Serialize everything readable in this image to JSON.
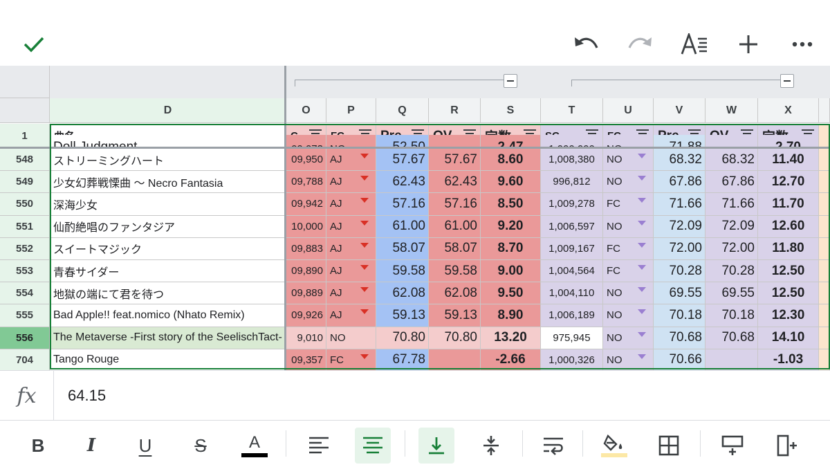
{
  "toolbar": {
    "icons": [
      "check-icon",
      "undo-icon",
      "redo-icon",
      "text-format-icon",
      "add-icon",
      "more-icon"
    ]
  },
  "columns": [
    {
      "id": "D",
      "label": "D"
    },
    {
      "id": "O",
      "label": "O"
    },
    {
      "id": "P",
      "label": "P"
    },
    {
      "id": "Q",
      "label": "Q"
    },
    {
      "id": "R",
      "label": "R"
    },
    {
      "id": "S",
      "label": "S"
    },
    {
      "id": "T",
      "label": "T"
    },
    {
      "id": "U",
      "label": "U"
    },
    {
      "id": "V",
      "label": "V"
    },
    {
      "id": "W",
      "label": "W"
    },
    {
      "id": "X",
      "label": "X"
    }
  ],
  "header_row": {
    "number": "1",
    "cells": [
      "曲名",
      "C",
      "FC",
      "Pre",
      "OV",
      "定数",
      "SC",
      "FC",
      "Pre",
      "OV",
      "定数"
    ]
  },
  "partial_top_row": [
    "Doll Judgment",
    "09,073",
    "NO",
    "52.50",
    "",
    "2.47",
    "1,000,000",
    "NO",
    "71.88",
    "",
    "2.70"
  ],
  "rows": [
    {
      "num": "548",
      "title": "ストリーミングハート",
      "o": "09,950",
      "p": "AJ",
      "q": "57.67",
      "r": "57.67",
      "s": "8.60",
      "t": "1,008,380",
      "u": "NO",
      "v": "68.32",
      "w": "68.32",
      "x": "11.40"
    },
    {
      "num": "549",
      "title": "少女幻葬戦慄曲 〜 Necro Fantasia",
      "o": "09,788",
      "p": "AJ",
      "q": "62.43",
      "r": "62.43",
      "s": "9.60",
      "t": "996,812",
      "u": "NO",
      "v": "67.86",
      "w": "67.86",
      "x": "12.70"
    },
    {
      "num": "550",
      "title": "深海少女",
      "o": "09,942",
      "p": "AJ",
      "q": "57.16",
      "r": "57.16",
      "s": "8.50",
      "t": "1,009,278",
      "u": "FC",
      "v": "71.66",
      "w": "71.66",
      "x": "11.70"
    },
    {
      "num": "551",
      "title": "仙酌絶唱のファンタジア",
      "o": "10,000",
      "p": "AJ",
      "q": "61.00",
      "r": "61.00",
      "s": "9.20",
      "t": "1,006,597",
      "u": "NO",
      "v": "72.09",
      "w": "72.09",
      "x": "12.60"
    },
    {
      "num": "552",
      "title": "スイートマジック",
      "o": "09,883",
      "p": "AJ",
      "q": "58.07",
      "r": "58.07",
      "s": "8.70",
      "t": "1,009,167",
      "u": "FC",
      "v": "72.00",
      "w": "72.00",
      "x": "11.80"
    },
    {
      "num": "553",
      "title": "青春サイダー",
      "o": "09,890",
      "p": "AJ",
      "q": "59.58",
      "r": "59.58",
      "s": "9.00",
      "t": "1,004,564",
      "u": "FC",
      "v": "70.28",
      "w": "70.28",
      "x": "12.50"
    },
    {
      "num": "554",
      "title": "地獄の端にて君を待つ",
      "o": "09,889",
      "p": "AJ",
      "q": "62.08",
      "r": "62.08",
      "s": "9.50",
      "t": "1,004,110",
      "u": "NO",
      "v": "69.55",
      "w": "69.55",
      "x": "12.50"
    },
    {
      "num": "555",
      "title": "Bad Apple!! feat.nomico (Nhato Remix)",
      "o": "09,926",
      "p": "AJ",
      "q": "59.13",
      "r": "59.13",
      "s": "8.90",
      "t": "1,006,189",
      "u": "NO",
      "v": "70.18",
      "w": "70.18",
      "x": "12.30"
    },
    {
      "num": "556",
      "title": "The Metaverse -First story of the SeelischTact-",
      "o": "9,010",
      "p": "NO",
      "q": "70.80",
      "r": "70.80",
      "s": "13.20",
      "t": "975,945",
      "u": "NO",
      "v": "70.68",
      "w": "70.68",
      "x": "14.10"
    },
    {
      "num": "704",
      "title": "Tango Rouge",
      "o": "09,357",
      "p": "FC",
      "q": "67.78",
      "r": "",
      "s": "-2.66",
      "t": "1,000,326",
      "u": "NO",
      "v": "70.66",
      "w": "",
      "x": "-1.03"
    }
  ],
  "formula_bar": {
    "icon": "fx-icon",
    "value": "64.15"
  },
  "format_toolbar": {
    "icons": [
      "bold-icon",
      "italic-icon",
      "underline-icon",
      "strikethrough-icon",
      "text-color-icon",
      "align-left-icon",
      "align-center-icon",
      "valign-bottom-icon",
      "valign-middle-icon",
      "wrap-text-icon",
      "fill-color-icon",
      "borders-icon",
      "insert-row-icon",
      "insert-column-icon"
    ],
    "bold_label": "B",
    "italic_label": "I",
    "underline_label": "U",
    "strike_label": "S",
    "textcolor_label": "A"
  },
  "colors": {
    "accent_green": "#188038",
    "red_cell": "#ea9999",
    "red_light": "#f4cccc",
    "blue_cell": "#a4c2f4",
    "blue_light": "#cfe2f3",
    "purple_cell": "#d9d2e9",
    "purple_header": "#b4a7d6",
    "selected_row": "#d9ead3"
  }
}
